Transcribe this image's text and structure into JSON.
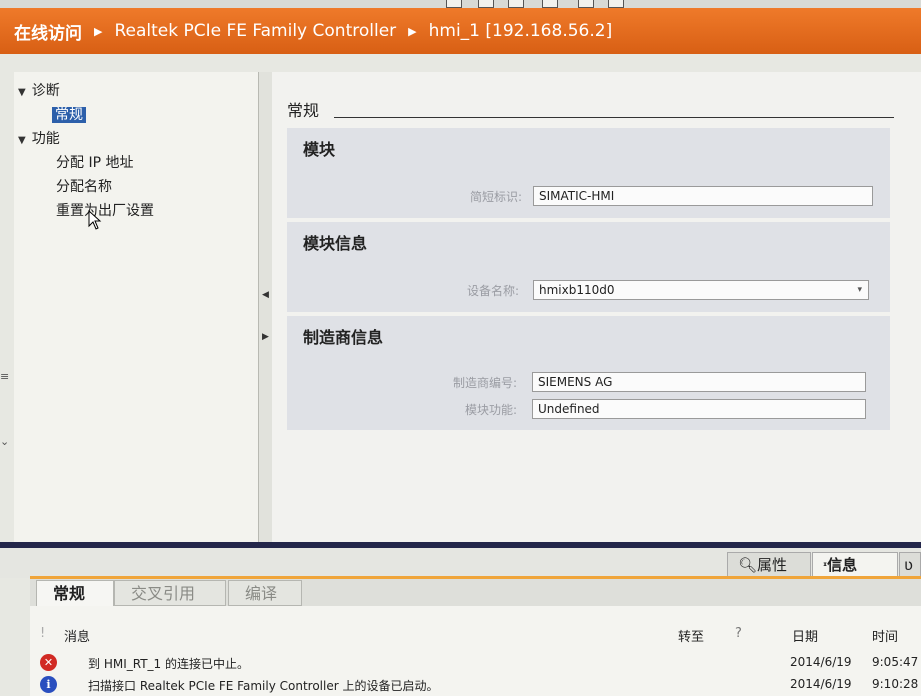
{
  "breadcrumb": {
    "items": [
      "在线访问",
      "Realtek PCIe FE Family Controller",
      "hmi_1 [192.168.56.2]"
    ]
  },
  "tree": {
    "diagnostics": "诊断",
    "general": "常规",
    "functions": "功能",
    "assign_ip": "分配 IP 地址",
    "assign_name": "分配名称",
    "factory_reset": "重置为出厂设置"
  },
  "content": {
    "section_title": "常规",
    "module": {
      "title": "模块",
      "short_name_label": "简短标识:",
      "short_name_value": "SIMATIC-HMI"
    },
    "module_info": {
      "title": "模块信息",
      "device_name_label": "设备名称:",
      "device_name_value": "hmixb110d0"
    },
    "manufacturer_info": {
      "title": "制造商信息",
      "manufacturer_label": "制造商编号:",
      "manufacturer_value": "SIEMENS AG",
      "module_function_label": "模块功能:",
      "module_function_value": "Undefined"
    }
  },
  "inspector": {
    "tabs": [
      "属性",
      "信息"
    ],
    "sub_tabs": [
      "常规",
      "交叉引用",
      "编译"
    ],
    "columns": {
      "message": "消息",
      "goto": "转至",
      "help": "?",
      "date": "日期",
      "time": "时间"
    },
    "messages": [
      {
        "type": "error",
        "text": "到 HMI_RT_1 的连接已中止。",
        "date": "2014/6/19",
        "time": "9:05:47"
      },
      {
        "type": "info",
        "text": "扫描接口 Realtek PCIe FE Family Controller 上的设备已启动。",
        "date": "2014/6/19",
        "time": "9:10:28"
      }
    ]
  },
  "colors": {
    "breadcrumb_bg": "#e56d1f",
    "selected_bg": "#2c5faa",
    "accent_line": "#f0a53a"
  }
}
